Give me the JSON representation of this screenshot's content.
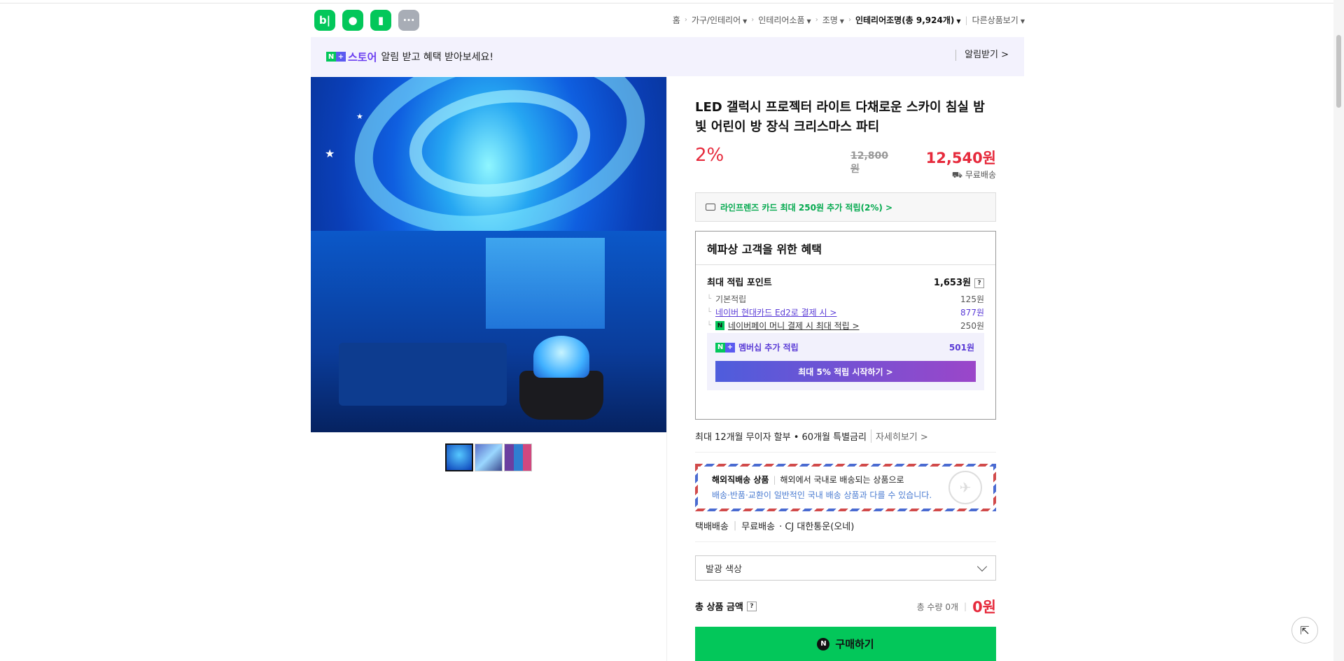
{
  "nav": {
    "apps": [
      {
        "label": "b|",
        "icon": "blog-icon"
      },
      {
        "label": "●",
        "icon": "cafe-icon"
      },
      {
        "label": "▮",
        "icon": "bookmark-icon"
      },
      {
        "label": "···",
        "icon": "more-icon"
      }
    ],
    "breadcrumb": [
      "홈",
      "가구/인테리어",
      "인테리어소품",
      "조명"
    ],
    "current_category": "인테리어조명(총 9,924개)",
    "other_products": "다른상품보기"
  },
  "store_banner": {
    "brand": "스토어",
    "message": "알림 받고 혜택 받아보세요!",
    "alarm_button": "알림받기 >"
  },
  "product": {
    "title": "LED 갤럭시 프로젝터 라이트 다채로운 스카이 침실 밤 빛 어린이 방 장식 크리스마스 파티",
    "discount": "2%",
    "original_price": "12,800원",
    "price": "12,540원",
    "shipping": "무료배송",
    "card_benefit": "라인프렌즈 카드 최대 250원 추가 적립(2%) >"
  },
  "benefits": {
    "heading": "헤파상 고객을 위한 혜택",
    "max_points_label": "최대 적립 포인트",
    "max_points_value": "1,653원",
    "help": "?",
    "rows": [
      {
        "label": "기본적립",
        "value": "125원"
      },
      {
        "label": "네이버 현대카드 Ed2로 결제 시 >",
        "value": "877원"
      },
      {
        "label": "네이버페이 머니 결제 시 최대 적립 >",
        "value": "250원"
      }
    ],
    "membership_label": "멤버십 추가 적립",
    "membership_value": "501원",
    "membership_button": "최대 5% 적립 시작하기 >"
  },
  "installment": {
    "text": "최대 12개월 무이자 할부 • 60개월 특별금리",
    "more": "자세히보기 >"
  },
  "overseas": {
    "title": "해외직배송 상품",
    "desc": "해외에서 국내로 배송되는 상품으로",
    "note": "배송·반품·교환이 일반적인 국내 배송 상품과 다를 수 있습니다."
  },
  "delivery": {
    "type": "택배배송",
    "fee": "무료배송",
    "carrier": "· CJ 대한통운(오네)"
  },
  "option": {
    "label": "발광 색상"
  },
  "total": {
    "label": "총 상품 금액",
    "quantity": "총 수량 0개",
    "amount": "0원"
  },
  "buy": {
    "label": "구매하기"
  },
  "colors": {
    "naver_green": "#03c75a",
    "price_red": "#e62a3c",
    "membership_purple": "#5a3bd6"
  }
}
